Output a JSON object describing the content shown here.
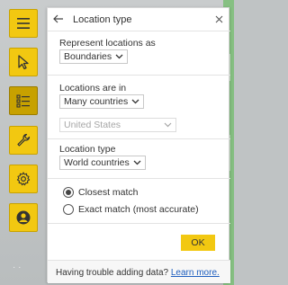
{
  "panel": {
    "title": "Location type",
    "represent": {
      "label": "Represent locations as",
      "value": "Boundaries"
    },
    "locations": {
      "label": "Locations are in",
      "value": "Many countries",
      "country_value": "United States"
    },
    "location_type": {
      "label": "Location type",
      "value": "World countries"
    },
    "match": {
      "options": [
        "Closest match",
        "Exact match (most accurate)"
      ],
      "selected": "Closest match"
    },
    "ok_label": "OK",
    "footer": {
      "text": "Having trouble adding data?",
      "link": "Learn more."
    }
  },
  "rail": {
    "items": [
      "menu-icon",
      "select-cursor-icon",
      "layer-list-icon",
      "wrench-icon",
      "gear-icon",
      "user-icon"
    ],
    "active": "layer-list-icon"
  },
  "colors": {
    "accent": "#f2c811",
    "accent_active": "#c7a100",
    "link": "#1f5fbf"
  },
  "page_indicator": "· ·"
}
